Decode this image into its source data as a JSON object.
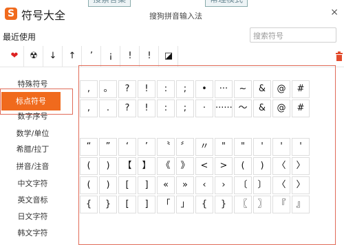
{
  "app": {
    "logo_char": "S",
    "title": "符号大全",
    "ime_name": "搜狗拼音输入法",
    "close": "×",
    "bg_tabs": [
      "搜索答案",
      "帮理模式"
    ]
  },
  "recent": {
    "label": "最近使用",
    "symbols": [
      "❤",
      "☢",
      "↓",
      "↑",
      "’",
      "¡",
      "!",
      "!",
      "◪"
    ]
  },
  "search": {
    "placeholder": "搜索符号"
  },
  "icons": {
    "trash": "trash-icon"
  },
  "sidebar": {
    "items": [
      {
        "label": "特殊符号",
        "active": false
      },
      {
        "label": "标点符号",
        "active": true
      },
      {
        "label": "数字序号",
        "active": false
      },
      {
        "label": "数学/单位",
        "active": false
      },
      {
        "label": "希腊/拉丁",
        "active": false
      },
      {
        "label": "拼音/注音",
        "active": false
      },
      {
        "label": "中文字符",
        "active": false
      },
      {
        "label": "英文音标",
        "active": false
      },
      {
        "label": "日文字符",
        "active": false
      },
      {
        "label": "韩文字符",
        "active": false
      }
    ]
  },
  "symbols": {
    "rows": [
      [
        ",",
        "。",
        "?",
        "!",
        ":",
        ";",
        "•",
        "···",
        "~",
        "&",
        "@",
        "#"
      ],
      [
        ",",
        ".",
        "?",
        "!",
        ":",
        ";",
        "·",
        "······",
        "～",
        "&",
        "@",
        "#"
      ],
      [
        "",
        "",
        "",
        "",
        "",
        "",
        "",
        "",
        "",
        "",
        "",
        ""
      ],
      [
        "“",
        "”",
        "‘",
        "’",
        "〝",
        "〞",
        "〃",
        "\"",
        "\"",
        "'",
        "'",
        "'"
      ],
      [
        "(",
        ")",
        "【",
        "】",
        "《",
        "》",
        "<",
        ">",
        "(",
        ")",
        "〈",
        "〉"
      ],
      [
        "(",
        ")",
        "[",
        "]",
        "«",
        "»",
        "‹",
        "›",
        "〔",
        "〕",
        "〈",
        "〉"
      ],
      [
        "{",
        "}",
        "[",
        "]",
        "「",
        "」",
        "{",
        "}",
        "〖",
        "〗",
        "『",
        "』"
      ]
    ]
  },
  "colors": {
    "accent": "#f06a1d",
    "frame": "#e06a57",
    "grid_border": "#dddddd"
  }
}
